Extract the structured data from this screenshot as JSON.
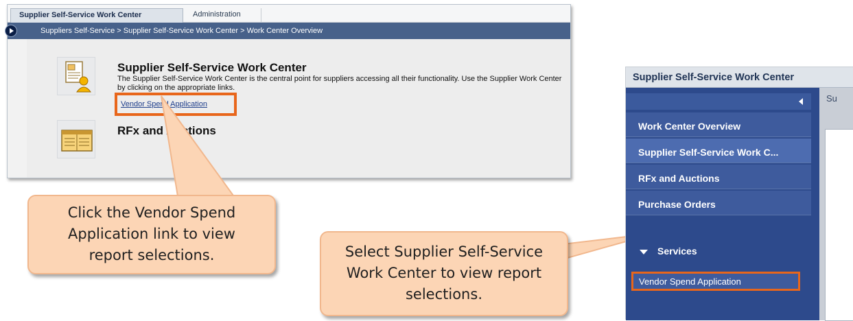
{
  "left_screen": {
    "tabs": [
      "Supplier Self-Service Work Center",
      "Administration"
    ],
    "breadcrumb": "Suppliers Self-Service  >  Supplier Self-Service Work Center  >  Work Center Overview",
    "section1_title": "Supplier Self-Service Work Center",
    "section1_desc": "The Supplier Self-Service Work Center is the central point for suppliers accessing all their functionality. Use the Supplier Work Center by clicking on the appropriate links.",
    "section1_link": "Vendor Spend Application",
    "section2_title": "RFx and Auctions"
  },
  "callout_left": {
    "text": "Click the Vendor Spend Application link to view report selections."
  },
  "callout_right": {
    "text": "Select Supplier Self-Service Work Center to view report selections."
  },
  "right_screen": {
    "title": "Supplier Self-Service Work Center",
    "nav_items": [
      "Work Center Overview",
      "Supplier Self-Service Work C...",
      "RFx and Auctions",
      "Purchase Orders"
    ],
    "services_label": "Services",
    "services_item": "Vendor Spend Application",
    "partial_tab": "Su"
  },
  "colors": {
    "highlight": "#e8661b",
    "callout_fill": "#fcd5b5",
    "nav_blue": "#2d4a8c"
  }
}
